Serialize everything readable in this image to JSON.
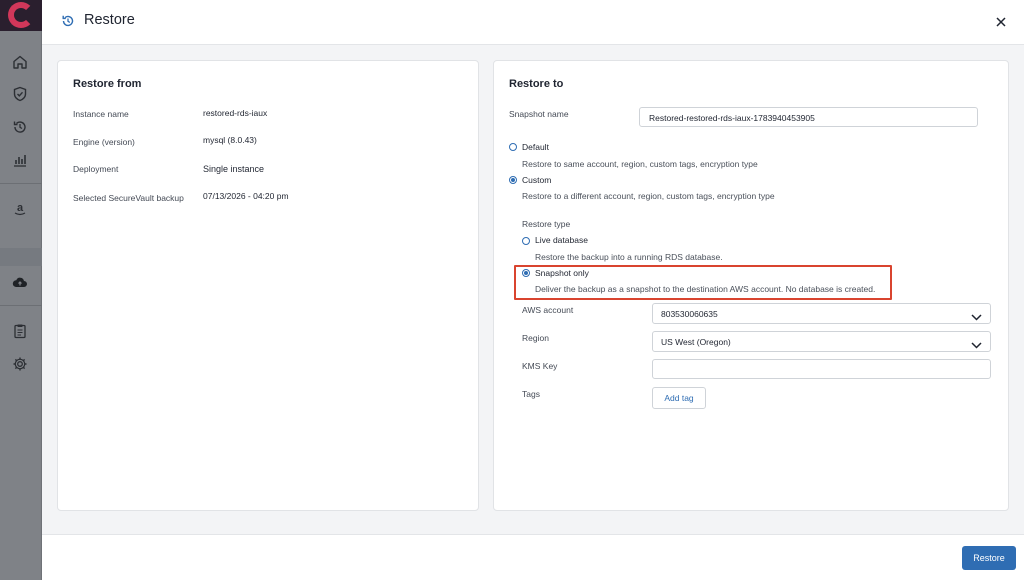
{
  "app": {
    "logo_name": "app-logo"
  },
  "sidebar": {
    "icons": [
      "home-icon",
      "shield-check-icon",
      "restore-icon",
      "chart-icon",
      "amazon-icon",
      "cloud-upload-icon",
      "clipboard-icon",
      "gear-icon"
    ]
  },
  "modal": {
    "title": "Restore",
    "close_icon": "close-icon"
  },
  "restore_from": {
    "title": "Restore from",
    "rows": [
      {
        "label": "Instance name",
        "value": "restored-rds-iaux"
      },
      {
        "label": "Engine (version)",
        "value": "mysql (8.0.43)"
      },
      {
        "label": "Deployment",
        "value": "Single instance"
      },
      {
        "label": "Selected SecureVault backup",
        "value": "07/13/2026 - 04:20 pm"
      }
    ]
  },
  "restore_to": {
    "title": "Restore to",
    "snapshot_name_label": "Snapshot name",
    "snapshot_name_value": "Restored-restored-rds-iaux-1783940453905",
    "options": {
      "default_label": "Default",
      "default_desc": "Restore to same account, region, custom tags, encryption type",
      "custom_label": "Custom",
      "custom_desc": "Restore to a different account, region, custom tags, encryption type",
      "selected": "Custom"
    },
    "restore_type": {
      "label": "Restore type",
      "live_label": "Live database",
      "live_desc": "Restore the backup into a running RDS database.",
      "snapshot_label": "Snapshot only",
      "snapshot_desc": "Deliver the backup as a snapshot to the destination AWS account. No database is created.",
      "selected": "Snapshot only"
    },
    "aws_account_label": "AWS account",
    "aws_account_value": "803530060635",
    "region_label": "Region",
    "region_value": "US West (Oregon)",
    "kms_key_label": "KMS Key",
    "kms_key_value": "",
    "tags_label": "Tags",
    "add_tag_label": "Add tag"
  },
  "footer": {
    "restore_label": "Restore"
  },
  "colors": {
    "accent": "#2f6db3",
    "highlight": "#d9442f",
    "logo": "#d1375a"
  }
}
